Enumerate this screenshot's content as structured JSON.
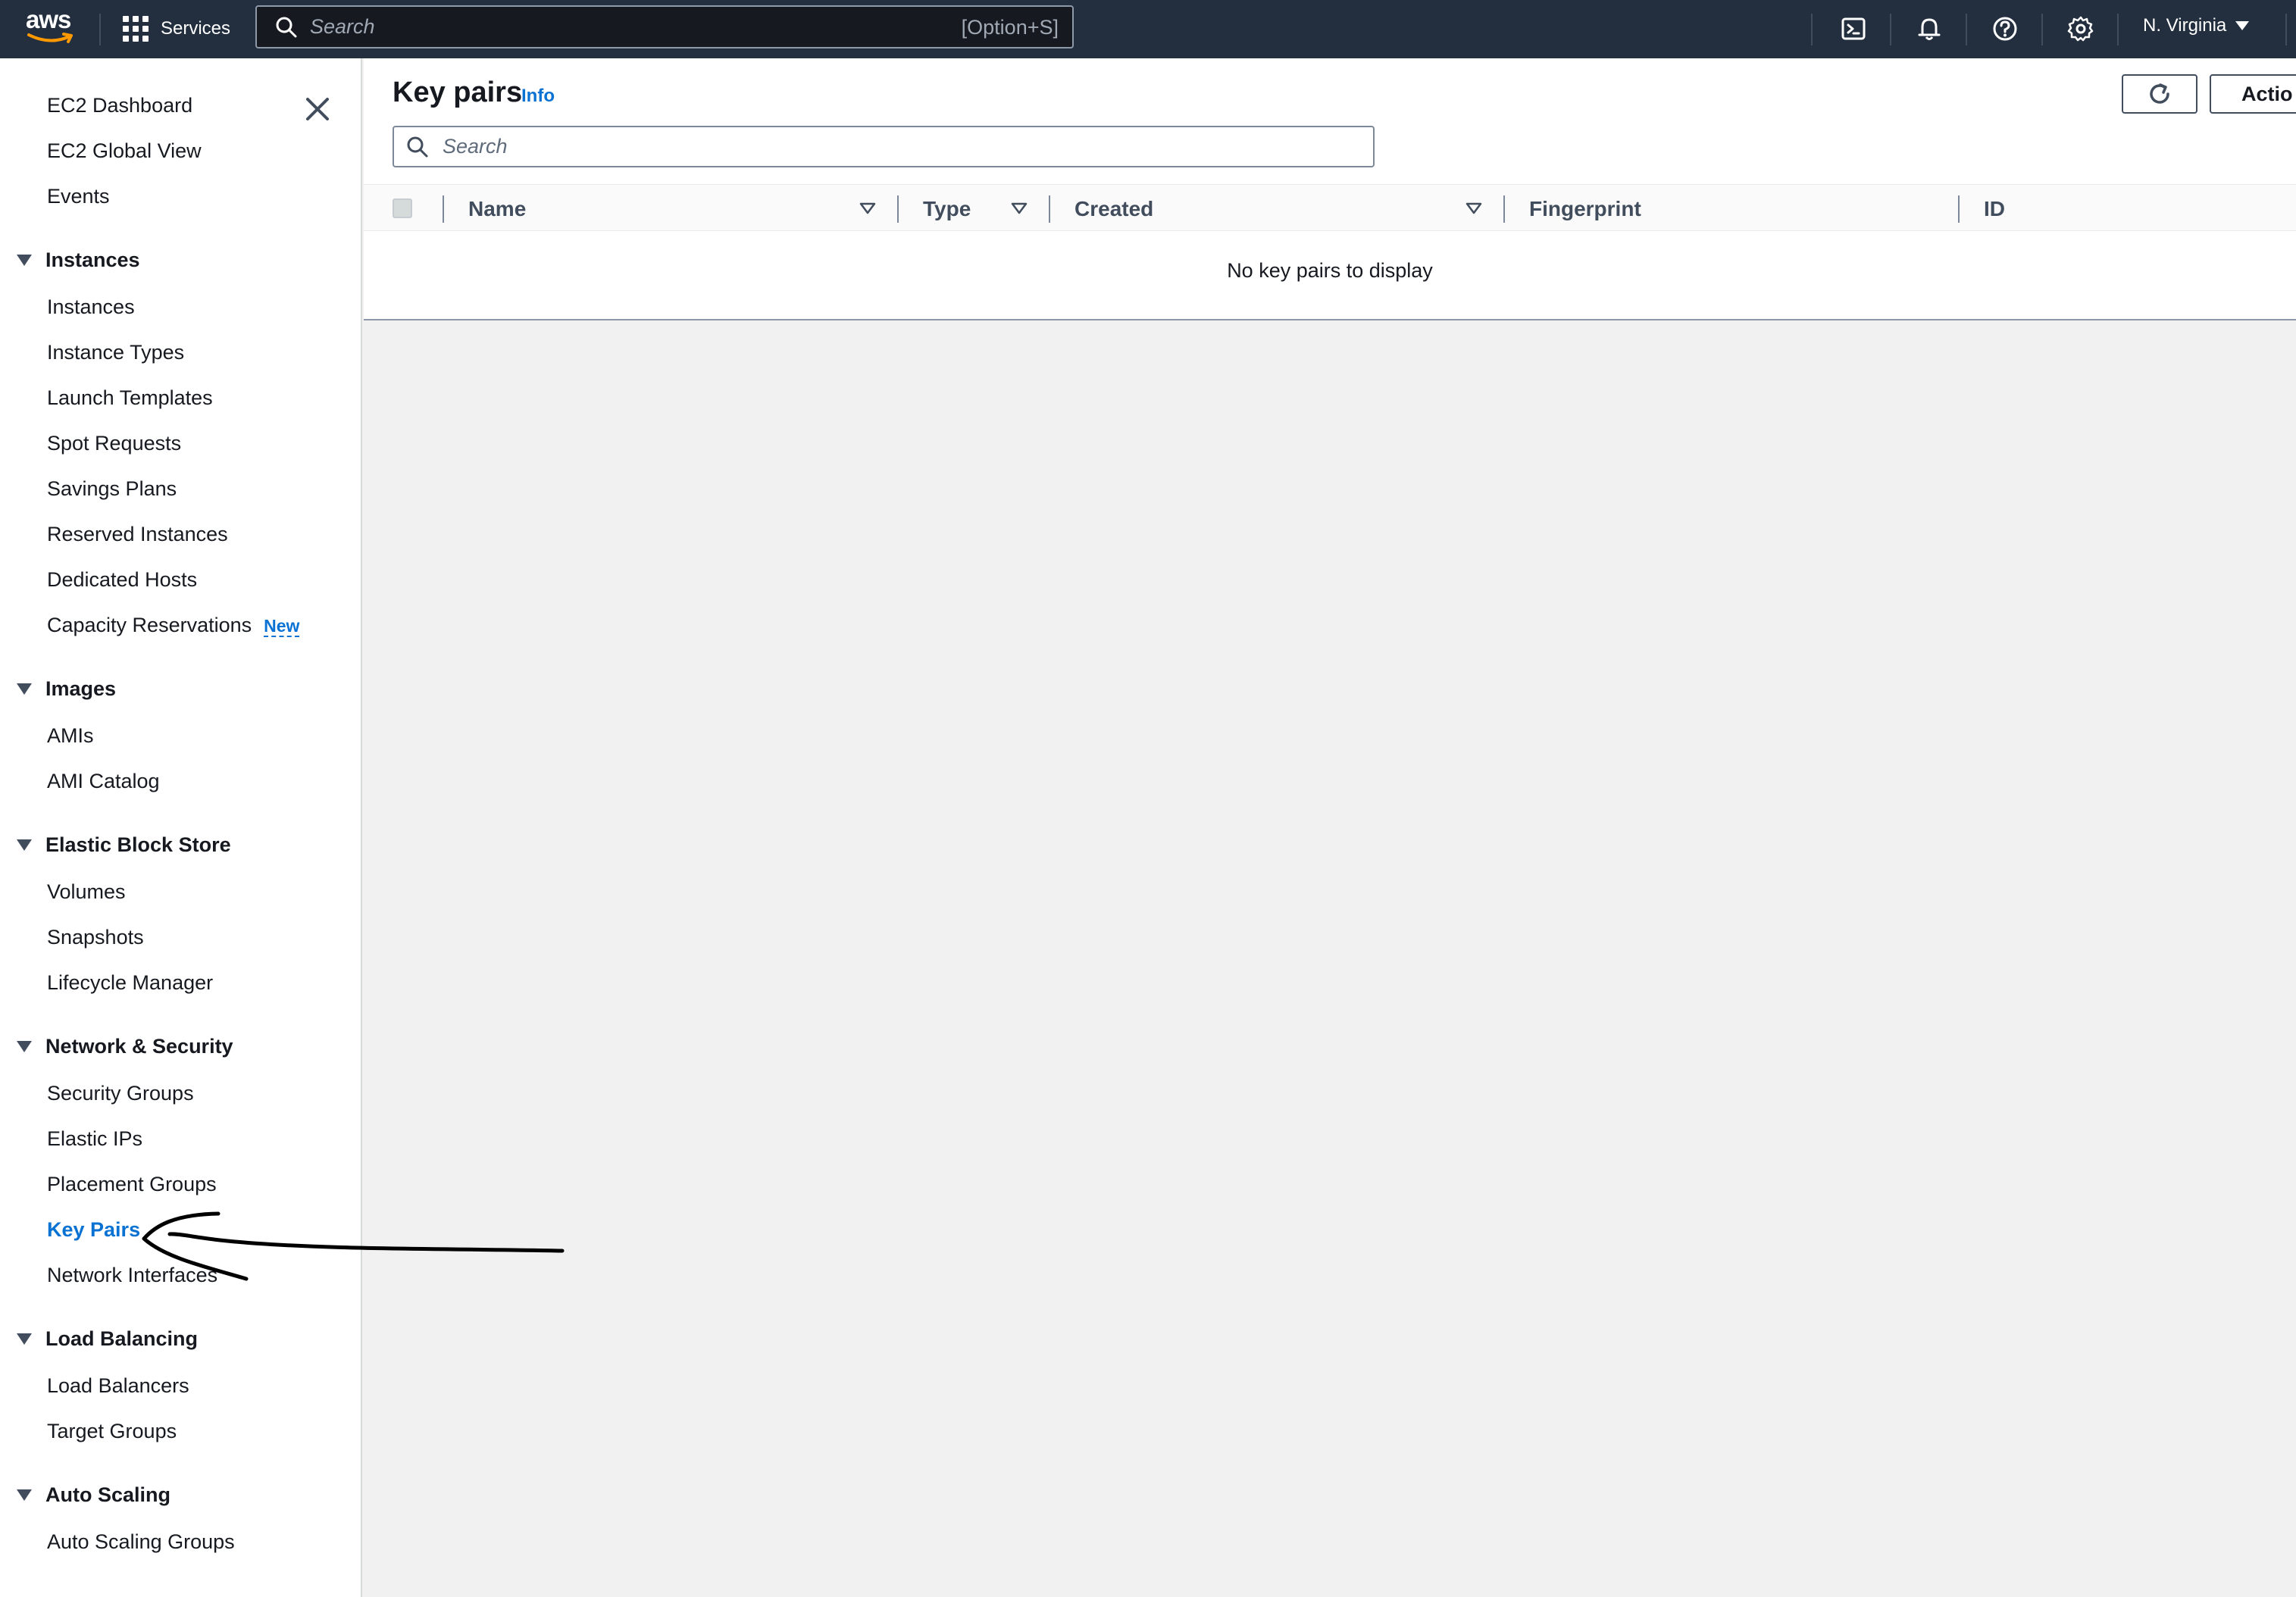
{
  "topnav": {
    "logo_text": "aws",
    "services_label": "Services",
    "search_placeholder": "Search",
    "search_shortcut": "[Option+S]",
    "icons": [
      "cloudshell-icon",
      "bell-icon",
      "help-icon",
      "gear-icon"
    ],
    "region_label": "N. Virginia"
  },
  "sidebar": {
    "top_links": [
      "EC2 Dashboard",
      "EC2 Global View",
      "Events"
    ],
    "sections": [
      {
        "title": "Instances",
        "items": [
          "Instances",
          "Instance Types",
          "Launch Templates",
          "Spot Requests",
          "Savings Plans",
          "Reserved Instances",
          "Dedicated Hosts",
          "Capacity Reservations"
        ],
        "badge": "New"
      },
      {
        "title": "Images",
        "items": [
          "AMIs",
          "AMI Catalog"
        ]
      },
      {
        "title": "Elastic Block Store",
        "items": [
          "Volumes",
          "Snapshots",
          "Lifecycle Manager"
        ]
      },
      {
        "title": "Network & Security",
        "items": [
          "Security Groups",
          "Elastic IPs",
          "Placement Groups",
          "Key Pairs",
          "Network Interfaces"
        ]
      },
      {
        "title": "Load Balancing",
        "items": [
          "Load Balancers",
          "Target Groups"
        ]
      },
      {
        "title": "Auto Scaling",
        "items": [
          "Auto Scaling Groups"
        ]
      }
    ],
    "active_item": "Key Pairs"
  },
  "main": {
    "title": "Key pairs",
    "info_label": "Info",
    "actions_label": "Actio",
    "search_placeholder": "Search",
    "columns": [
      "Name",
      "Type",
      "Created",
      "Fingerprint",
      "ID"
    ],
    "empty_message": "No key pairs to display"
  },
  "colors": {
    "nav_bg": "#232f3e",
    "link_blue": "#0972d3",
    "page_bg": "#f0f1f0"
  }
}
